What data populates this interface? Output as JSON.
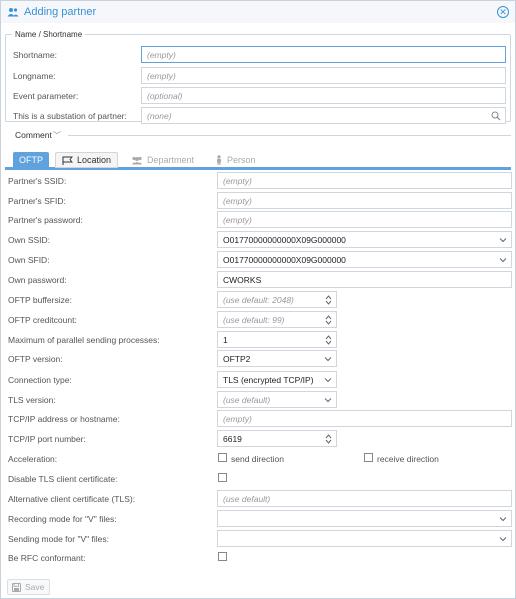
{
  "window": {
    "title": "Adding partner"
  },
  "name_group": {
    "legend": "Name / Shortname",
    "fields": [
      {
        "label": "Shortname:",
        "placeholder": "(empty)"
      },
      {
        "label": "Longname:",
        "placeholder": "(empty)"
      },
      {
        "label": "Event parameter:",
        "placeholder": "(optional)"
      },
      {
        "label": "This is a substation of partner:",
        "placeholder": "(none)"
      }
    ]
  },
  "comment": {
    "label": "Comment"
  },
  "tabs": [
    {
      "label": "OFTP",
      "state": "active"
    },
    {
      "label": "Location",
      "state": "enabled"
    },
    {
      "label": "Department",
      "state": "disabled"
    },
    {
      "label": "Person",
      "state": "disabled"
    }
  ],
  "oftp": {
    "partner_ssid": {
      "label": "Partner's SSID:",
      "placeholder": "(empty)"
    },
    "partner_sfid": {
      "label": "Partner's SFID:",
      "placeholder": "(empty)"
    },
    "partner_password": {
      "label": "Partner's password:",
      "placeholder": "(empty)"
    },
    "own_ssid": {
      "label": "Own SSID:",
      "value": "O01770000000000X09G000000"
    },
    "own_sfid": {
      "label": "Own SFID:",
      "value": "O01770000000000X09G000000"
    },
    "own_password": {
      "label": "Own password:",
      "value": "CWORKS"
    },
    "buffersize": {
      "label": "OFTP buffersize:",
      "placeholder": "(use default: 2048)"
    },
    "creditcount": {
      "label": "OFTP creditcount:",
      "placeholder": "(use default: 99)"
    },
    "max_parallel": {
      "label": "Maximum of parallel sending processes:",
      "value": "1"
    },
    "version": {
      "label": "OFTP version:",
      "value": "OFTP2"
    },
    "connection_type": {
      "label": "Connection type:",
      "value": "TLS (encrypted TCP/IP)"
    },
    "tls_version": {
      "label": "TLS version:",
      "placeholder": "(use default)"
    },
    "tcpip_address": {
      "label": "TCP/IP address or hostname:",
      "placeholder": "(empty)"
    },
    "tcpip_port": {
      "label": "TCP/IP port number:",
      "value": "6619"
    },
    "acceleration": {
      "label": "Acceleration:",
      "send_label": "send direction",
      "receive_label": "receive direction",
      "send_checked": false,
      "receive_checked": false
    },
    "disable_tls_cert": {
      "label": "Disable TLS client certificate:",
      "checked": false
    },
    "alt_client_cert": {
      "label": "Alternative client certificate (TLS):",
      "placeholder": "(use default)"
    },
    "recording_mode_v": {
      "label": "Recording mode for \"V\" files:",
      "value": ""
    },
    "sending_mode_v": {
      "label": "Sending mode for \"V\" files:",
      "value": ""
    },
    "rfc_conformant": {
      "label": "Be RFC conformant:",
      "checked": false
    }
  },
  "footer": {
    "save_label": "Save"
  },
  "colors": {
    "accent": "#3892d4",
    "tab_active": "#5fa2dd",
    "border": "#cfd6de"
  }
}
